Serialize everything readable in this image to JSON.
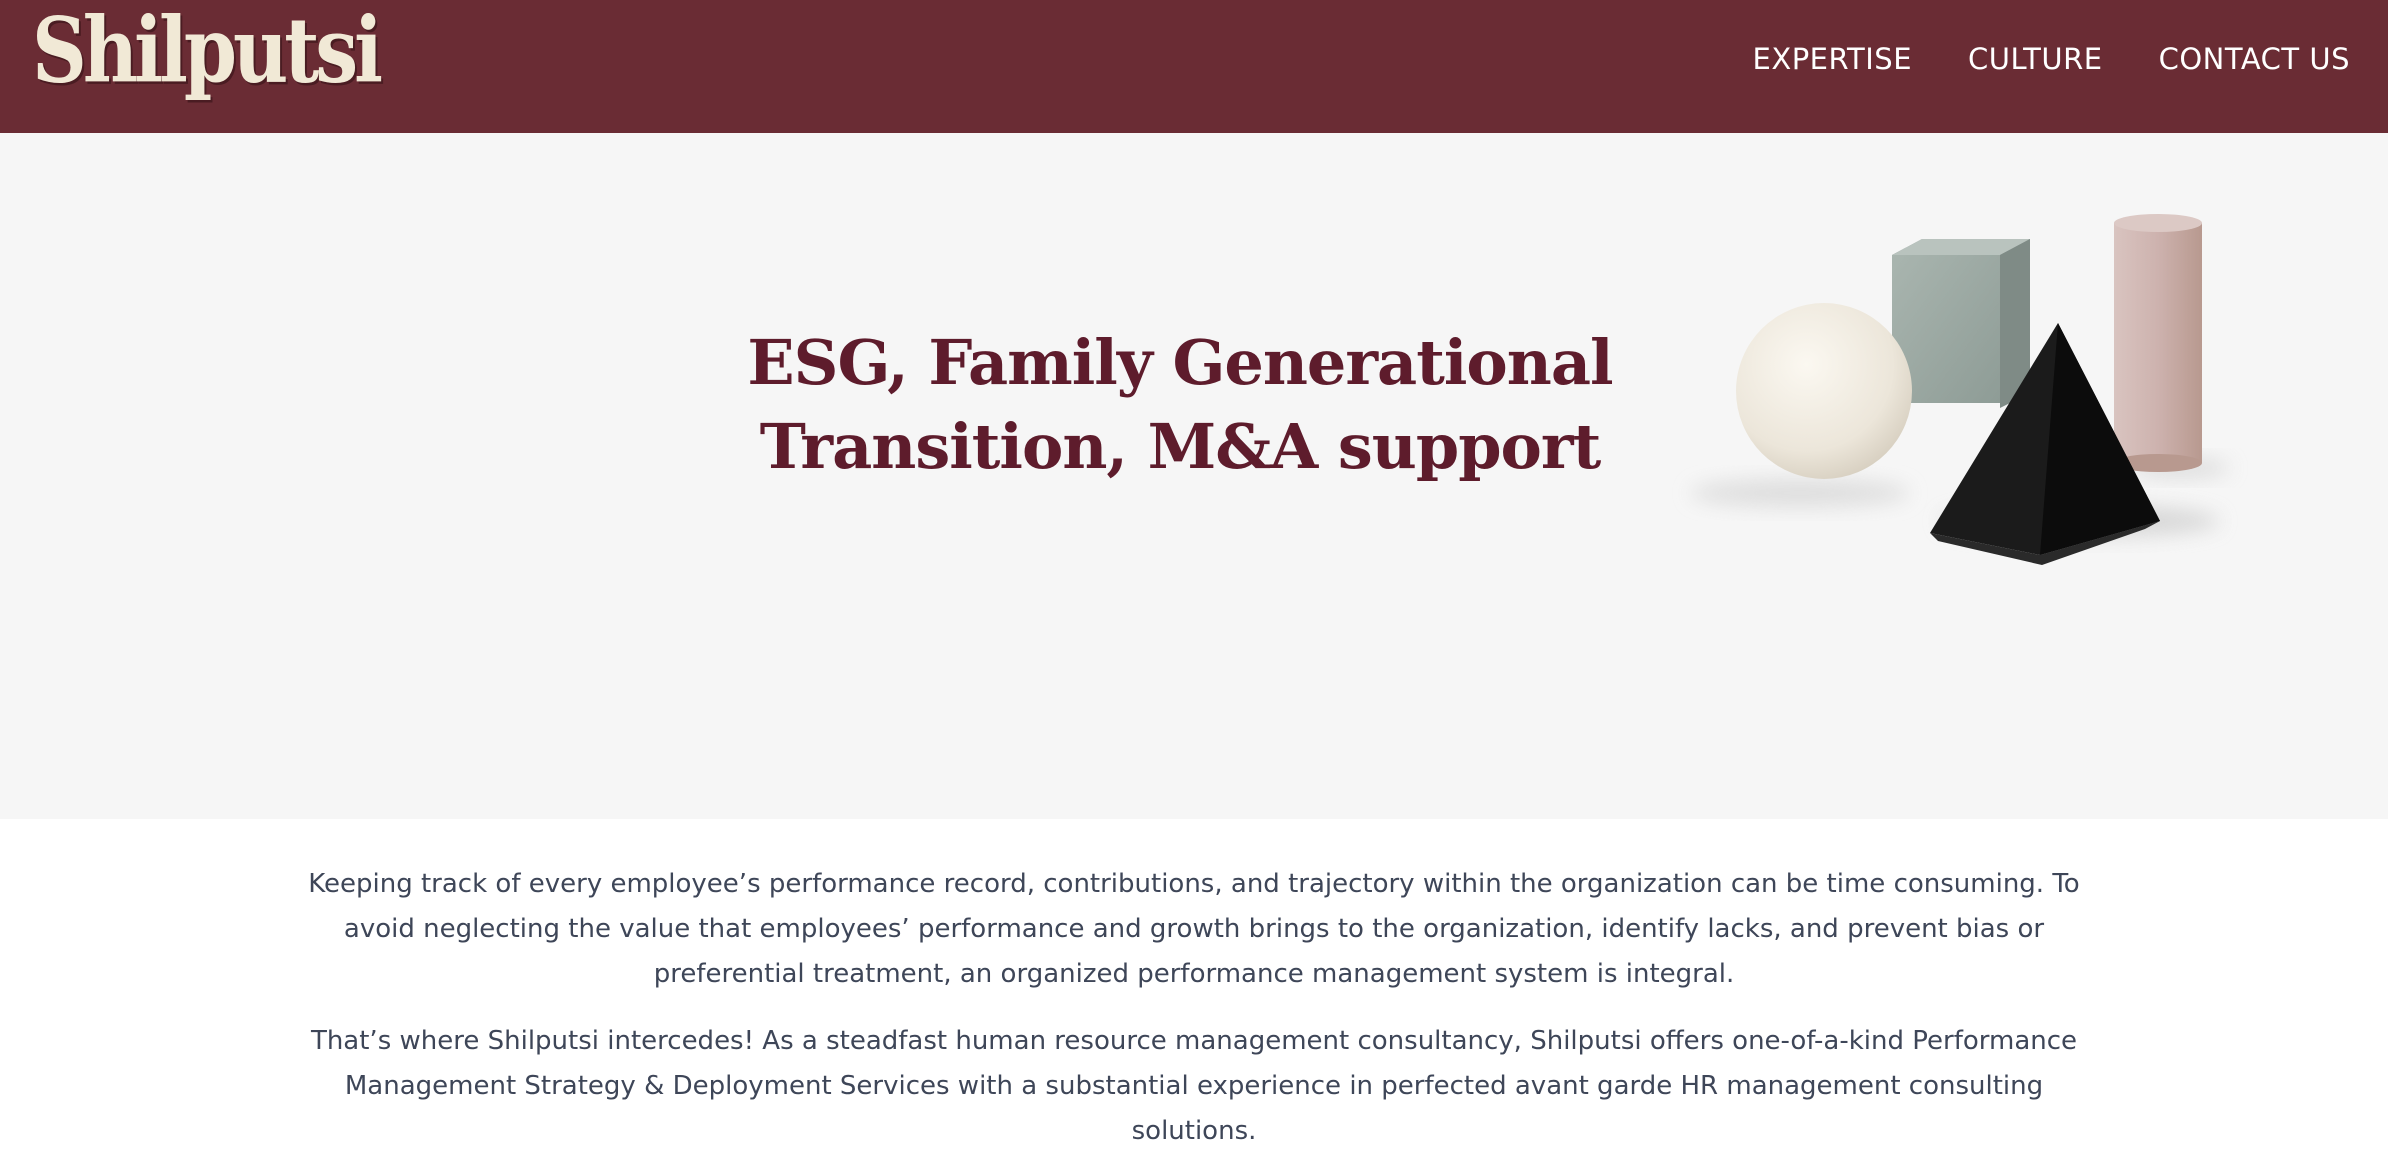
{
  "brand": {
    "logo_text": "Shilputsi",
    "header_color": "#6a2c34",
    "logo_color": "#f1e9d6"
  },
  "nav": {
    "items": [
      {
        "label": "EXPERTISE"
      },
      {
        "label": "CULTURE"
      },
      {
        "label": "CONTACT US"
      }
    ]
  },
  "hero": {
    "title_line1": "ESG, Family Generational",
    "title_line2": "Transition, M&A support",
    "title_color": "#5e1c2c",
    "background": "#f6f6f6",
    "image_icon": "geometric-shapes-illustration"
  },
  "intro": {
    "paragraph1": "Keeping track of every employee’s performance record, contributions, and trajectory within the organization can be time consuming. To avoid neglecting the value that employees’ performance and growth brings to the organization, identify lacks, and prevent bias or preferential treatment, an organized performance management system is integral.",
    "paragraph2": "That’s where Shilputsi intercedes! As a steadfast human resource management consultancy, Shilputsi offers one-of-a-kind Performance Management Strategy & Deployment Services with a substantial experience in perfected avant garde HR management consulting solutions."
  }
}
